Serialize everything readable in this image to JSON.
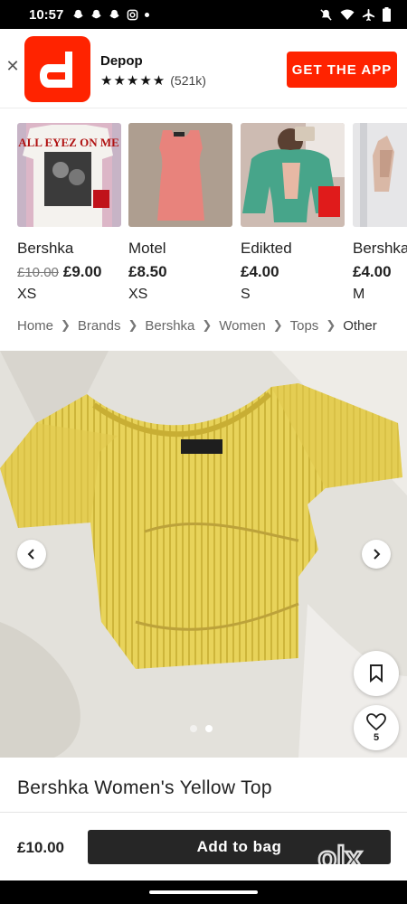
{
  "status_bar": {
    "time": "10:57"
  },
  "banner": {
    "app_name": "Depop",
    "stars": "★★★★★",
    "rating_count": "(521k)",
    "cta": "GET THE APP",
    "brand_color": "#ff2300"
  },
  "carousel": {
    "items": [
      {
        "brand": "Bershka",
        "old_price": "£10.00",
        "price": "£9.00",
        "size": "XS",
        "thumb_text": "ALL EYEZ ON ME"
      },
      {
        "brand": "Motel",
        "old_price": "",
        "price": "£8.50",
        "size": "XS"
      },
      {
        "brand": "Edikted",
        "old_price": "",
        "price": "£4.00",
        "size": "S"
      },
      {
        "brand": "Bershka",
        "old_price": "",
        "price": "£4.00",
        "size": "M"
      }
    ]
  },
  "breadcrumb": [
    "Home",
    "Brands",
    "Bershka",
    "Women",
    "Tops",
    "Other"
  ],
  "product": {
    "title": "Bershka Women's Yellow Top",
    "likes": "5",
    "image_count": 2,
    "active_image": 2
  },
  "bottom_bar": {
    "price": "£10.00",
    "add_label": "Add to bag"
  },
  "watermark": "olx"
}
